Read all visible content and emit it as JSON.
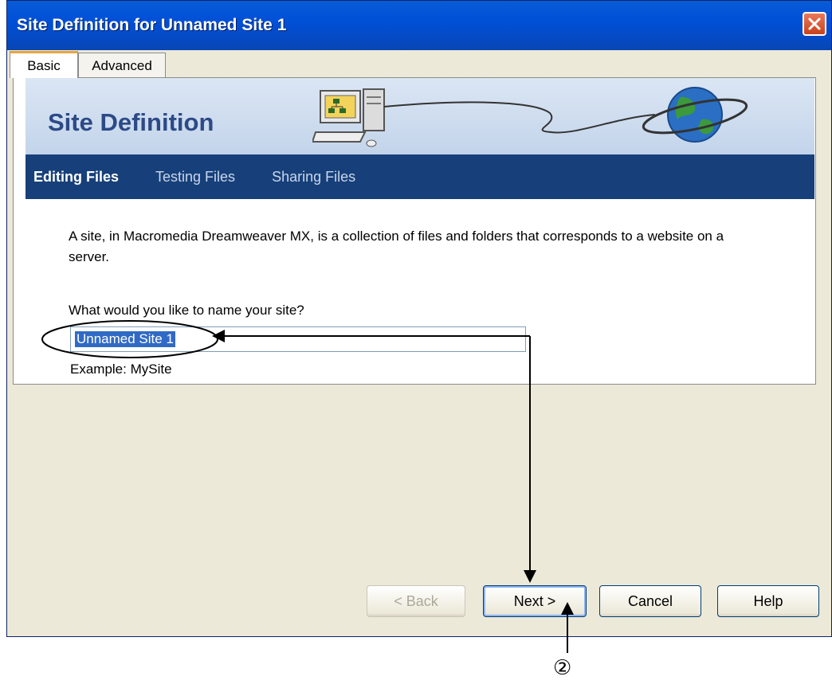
{
  "window": {
    "title": "Site Definition for Unnamed Site 1"
  },
  "tabs": [
    {
      "label": "Basic"
    },
    {
      "label": "Advanced"
    }
  ],
  "banner": {
    "heading": "Site Definition"
  },
  "nav": [
    {
      "label": "Editing Files"
    },
    {
      "label": "Testing Files"
    },
    {
      "label": "Sharing Files"
    }
  ],
  "content": {
    "description": "A site, in Macromedia Dreamweaver MX, is a collection of files and folders that corresponds to a website on a server.",
    "question": "What would you like to name your site?",
    "site_name_value": "Unnamed Site 1",
    "example": "Example: MySite"
  },
  "buttons": {
    "back": "< Back",
    "next": "Next >",
    "cancel": "Cancel",
    "help": "Help"
  },
  "annotation": {
    "callout_number": "②"
  },
  "icons": {
    "close": "close-icon",
    "computer": "computer-icon",
    "globe": "globe-icon"
  }
}
